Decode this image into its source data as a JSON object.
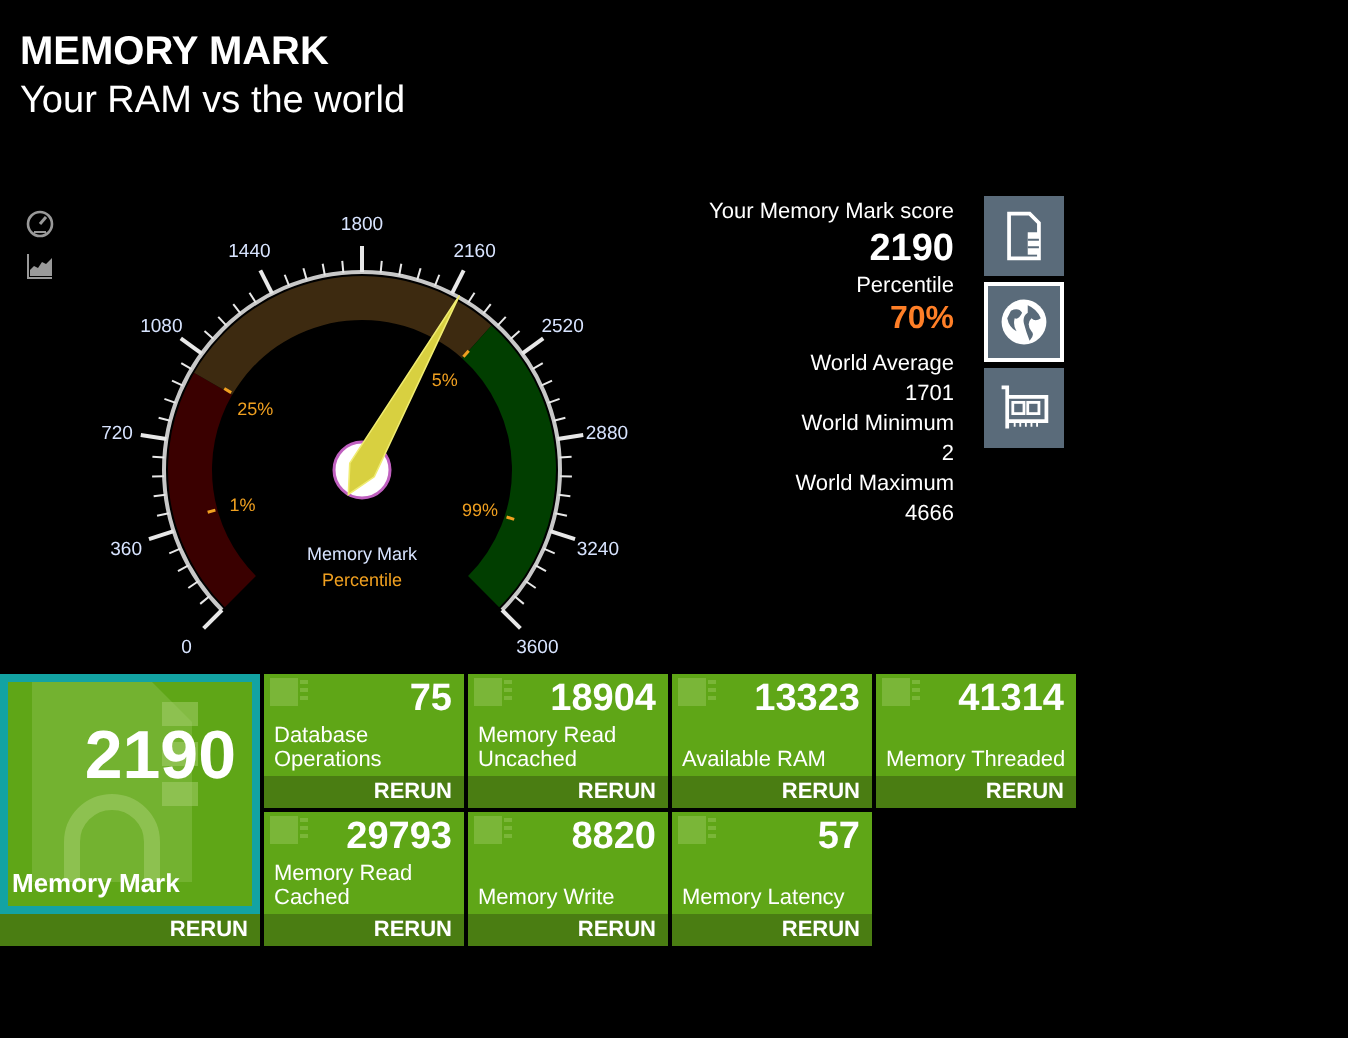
{
  "header": {
    "title": "MEMORY MARK",
    "subtitle": "Your RAM vs the world"
  },
  "gauge": {
    "scale_labels": [
      "0",
      "360",
      "720",
      "1080",
      "1440",
      "1800",
      "2160",
      "2520",
      "2880",
      "3240",
      "3600"
    ],
    "percentile_marks": [
      "1%",
      "25%",
      "5%",
      "99%"
    ],
    "caption": "Memory Mark",
    "subcaption": "Percentile"
  },
  "summary": {
    "score_label": "Your Memory Mark score",
    "score": "2190",
    "percentile_label": "Percentile",
    "percentile": "70%",
    "stats": [
      {
        "label": "World Average",
        "value": "1701"
      },
      {
        "label": "World Minimum",
        "value": "2"
      },
      {
        "label": "World Maximum",
        "value": "4666"
      }
    ]
  },
  "view_buttons": [
    {
      "kind": "document",
      "selected": false
    },
    {
      "kind": "globe",
      "selected": true
    },
    {
      "kind": "card",
      "selected": false
    }
  ],
  "main_tile": {
    "value": "2190",
    "label": "Memory Mark",
    "action": "RERUN",
    "selected": true
  },
  "tiles": [
    {
      "value": "75",
      "label": "Database Operations",
      "action": "RERUN"
    },
    {
      "value": "18904",
      "label": "Memory Read Uncached",
      "action": "RERUN"
    },
    {
      "value": "13323",
      "label": "Available RAM",
      "action": "RERUN"
    },
    {
      "value": "41314",
      "label": "Memory Threaded",
      "action": "RERUN"
    },
    {
      "value": "29793",
      "label": "Memory Read Cached",
      "action": "RERUN"
    },
    {
      "value": "8820",
      "label": "Memory Write",
      "action": "RERUN"
    },
    {
      "value": "57",
      "label": "Memory Latency",
      "action": "RERUN"
    }
  ]
}
